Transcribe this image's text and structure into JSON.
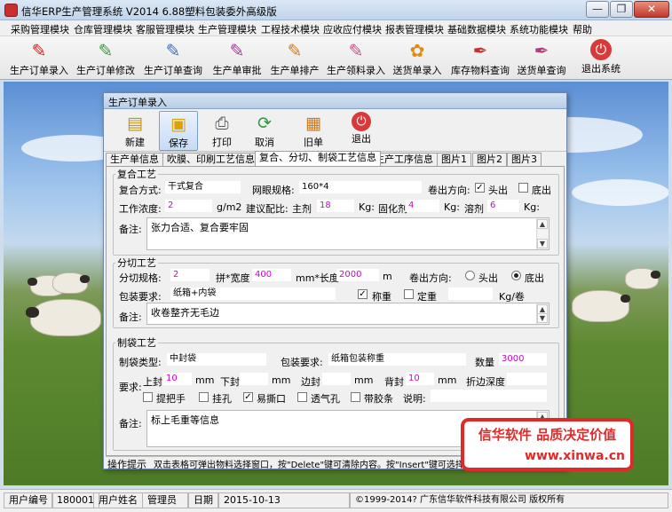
{
  "window": {
    "title": "信华ERP生产管理系统  V2014  6.88塑料包装委外高级版",
    "minimize": "—",
    "restore": "❐",
    "close": "✕"
  },
  "menu": [
    "采购管理模块",
    "仓库管理模块",
    "客服管理模块",
    "生产管理模块",
    "工程技术模块",
    "应收应付模块",
    "报表管理模块",
    "基础数据模块",
    "系统功能模块",
    "帮助"
  ],
  "toolbar": [
    {
      "label": "生产订单录入",
      "icon": "doc-red-icon"
    },
    {
      "label": "生产订单修改",
      "icon": "doc-green-icon"
    },
    {
      "label": "生产订单查询",
      "icon": "doc-blue-icon"
    },
    {
      "label": "生产单审批",
      "icon": "doc-purple-icon"
    },
    {
      "label": "生产单排产",
      "icon": "doc-orange-icon"
    },
    {
      "label": "生产领料录入",
      "icon": "doc-pink-icon"
    },
    {
      "label": "送货单录入",
      "icon": "flower-icon"
    },
    {
      "label": "库存物料查询",
      "icon": "pen-icon"
    },
    {
      "label": "送货单查询",
      "icon": "quill-icon"
    },
    {
      "label": "退出系统",
      "icon": "exit-icon"
    }
  ],
  "dialog": {
    "title": "生产订单录入",
    "buttons": [
      {
        "label": "新建",
        "icon": "new-icon"
      },
      {
        "label": "保存",
        "icon": "save-icon"
      },
      {
        "label": "打印",
        "icon": "print-icon"
      },
      {
        "label": "取消",
        "icon": "refresh-icon"
      },
      {
        "label": "旧单",
        "icon": "folder-icon"
      },
      {
        "label": "退出",
        "icon": "exit-icon"
      }
    ],
    "tabs": [
      "生产单信息",
      "吹膜、印刷工艺信息",
      "复合、分切、制袋工艺信息",
      "生产工序信息",
      "图片1",
      "图片2",
      "图片3"
    ],
    "active_tab": 2,
    "composite": {
      "legend": "复合工艺",
      "method_label": "复合方式:",
      "method": "干式复合",
      "mesh_label": "网眼规格:",
      "mesh": "160*4",
      "out_dir_label": "卷出方向:",
      "head_out": "头出",
      "tail_out": "底出",
      "head_out_checked": true,
      "tail_out_checked": false,
      "concentration_label": "工作浓度:",
      "concentration": "2",
      "concentration_unit": "g/m2",
      "ratio_label": "建议配比:",
      "main_agent_label": "主剂",
      "main_agent": "18",
      "kg": "Kg:",
      "curing_label": "固化剂",
      "curing": "4",
      "solvent_label": "溶剂",
      "solvent": "6",
      "remark_label": "备注:",
      "remark": "张力合适、复合要牢固"
    },
    "slitting": {
      "legend": "分切工艺",
      "spec_label": "分切规格:",
      "spec": "2",
      "splice_label": "拼*宽度",
      "width": "400",
      "mm_len": "mm*长度",
      "length": "2000",
      "m": "m",
      "out_dir_label": "卷出方向:",
      "head_out": "头出",
      "tail_out": "底出",
      "tail_selected": true,
      "pack_label": "包装要求:",
      "pack": "纸箱+内袋",
      "weigh": "称重",
      "weigh_checked": true,
      "fixed": "定重",
      "fixed_checked": false,
      "fixed_value": "",
      "kg_roll": "Kg/卷",
      "remark_label": "备注:",
      "remark": "收卷整齐无毛边"
    },
    "bagging": {
      "legend": "制袋工艺",
      "type_label": "制袋类型:",
      "type": "中封袋",
      "pack_label": "包装要求:",
      "pack": "纸箱包装称重",
      "qty_label": "数量",
      "qty": "3000",
      "req_label": "要求:",
      "top_seal_label": "上封",
      "top_seal": "10",
      "mm": "mm",
      "bottom_seal_label": "下封",
      "bottom_seal": "",
      "side_seal_label": "边封",
      "side_seal": "",
      "back_seal_label": "背封",
      "back_seal": "10",
      "fold_label": "折边深度",
      "fold": "",
      "options": [
        {
          "label": "提把手",
          "checked": false
        },
        {
          "label": "挂孔",
          "checked": false
        },
        {
          "label": "易撕口",
          "checked": true
        },
        {
          "label": "透气孔",
          "checked": false
        },
        {
          "label": "带胶条",
          "checked": false
        }
      ],
      "note_label": "说明:",
      "note": "",
      "remark_label": "备注:",
      "remark": "标上毛重等信息"
    },
    "hint_label": "操作提示",
    "hint": "双击表格可弹出物料选择窗口，按\"Delete\"键可清除内容。按\"Insert\"键可选择插"
  },
  "promo": {
    "line1": "信华软件  品质决定价值",
    "line2": "www.xinwa.cn"
  },
  "status": {
    "user_no_label": "用户编号",
    "user_no": "180001",
    "user_name_label": "用户姓名",
    "user_name": "管理员",
    "date_label": "日期",
    "date": "2015-10-13",
    "copyright": "©1999-2014?  广东信华软件科技有限公司   版权所有"
  }
}
